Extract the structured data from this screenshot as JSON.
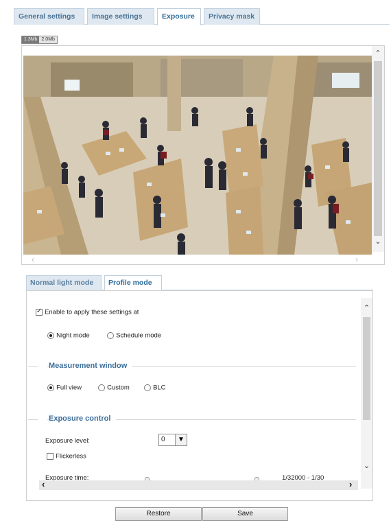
{
  "tabs": [
    "General settings",
    "Image settings",
    "Exposure",
    "Privacy mask"
  ],
  "resolution_buttons": [
    "1.3Mb",
    "2.0Mb"
  ],
  "video": {
    "scroll_up_icon": "chevron-up-icon",
    "scroll_down_icon": "chevron-down-icon",
    "scroll_left_icon": "chevron-left-icon",
    "scroll_right_icon": "chevron-right-icon"
  },
  "mode_tabs": [
    "Normal light mode",
    "Profile mode"
  ],
  "profile": {
    "enable_label": "Enable to apply these settings at",
    "enable_checked": true,
    "mode_options": [
      "Night mode",
      "Schedule mode"
    ],
    "mode_selected": "Night mode"
  },
  "measurement": {
    "title": "Measurement window",
    "options": [
      "Full view",
      "Custom",
      "BLC"
    ],
    "selected": "Full view"
  },
  "exposure_control": {
    "title": "Exposure control",
    "level_label": "Exposure level:",
    "level_value": "0",
    "flickerless_label": "Flickerless",
    "flickerless_checked": false,
    "time_label": "Exposure time:",
    "time_value": "1/32000 - 1/30"
  },
  "buttons": {
    "restore": "Restore",
    "save": "Save"
  },
  "colors": {
    "accent": "#3c6f9a",
    "tab_bg": "#dfe8f0",
    "slider": "#3f78b2"
  }
}
